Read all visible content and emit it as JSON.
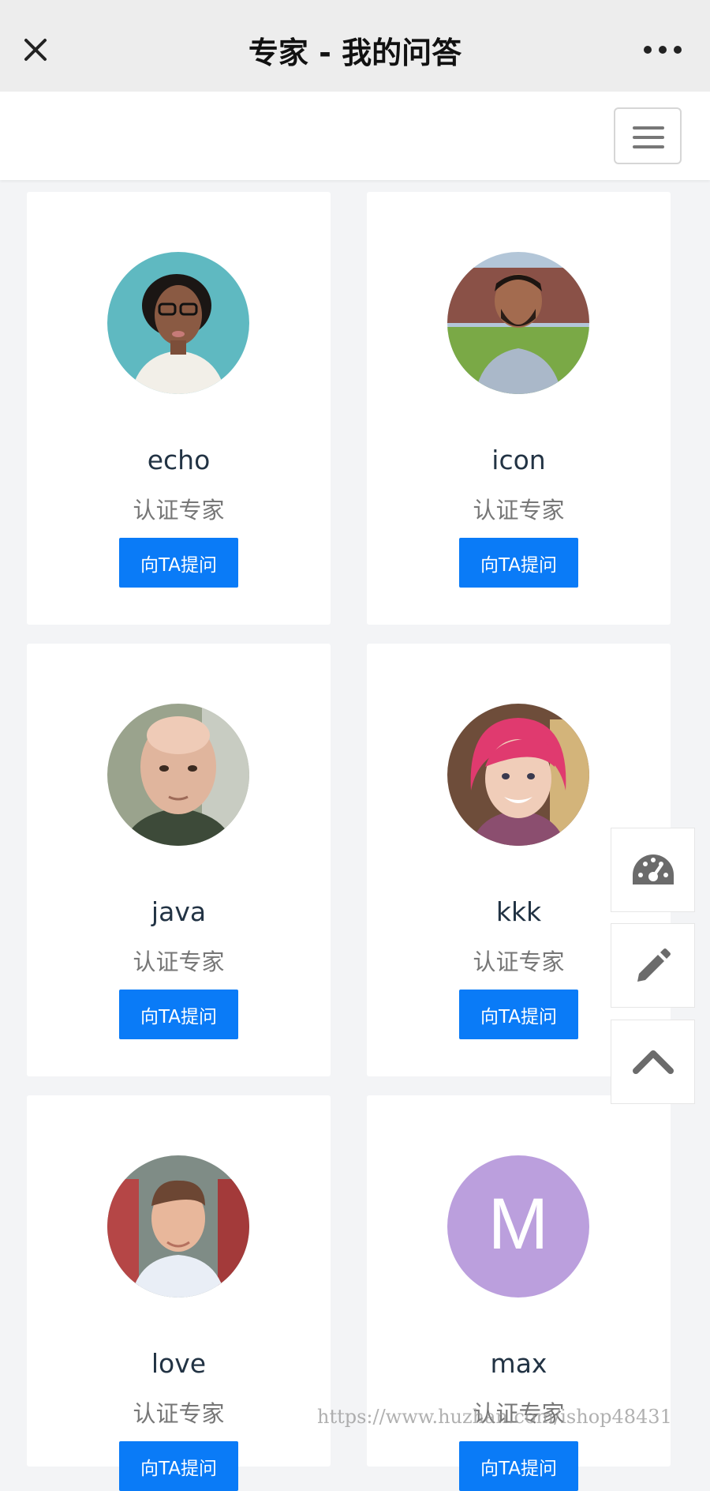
{
  "header": {
    "title": "专家 - 我的问答",
    "close_icon": "close-icon",
    "more_icon": "more-dots-icon"
  },
  "navbar": {
    "menu_icon": "hamburger-menu-icon"
  },
  "experts": [
    {
      "name": "echo",
      "role": "认证专家",
      "ask_label": "向TA提问"
    },
    {
      "name": "icon",
      "role": "认证专家",
      "ask_label": "向TA提问"
    },
    {
      "name": "java",
      "role": "认证专家",
      "ask_label": "向TA提问"
    },
    {
      "name": "kkk",
      "role": "认证专家",
      "ask_label": "向TA提问"
    },
    {
      "name": "love",
      "role": "认证专家",
      "ask_label": "向TA提问"
    },
    {
      "name": "max",
      "role": "认证专家",
      "ask_label": "向TA提问",
      "avatar_letter": "M",
      "avatar_color": "#bb9fdd"
    }
  ],
  "floating_actions": [
    {
      "icon": "dashboard-icon"
    },
    {
      "icon": "pencil-icon"
    },
    {
      "icon": "chevron-up-icon"
    }
  ],
  "watermark": "https://www.huzhan.com/ishop48431",
  "colors": {
    "primary": "#0a7bf7",
    "header_bg": "#ededed",
    "page_bg": "#f3f4f6"
  }
}
